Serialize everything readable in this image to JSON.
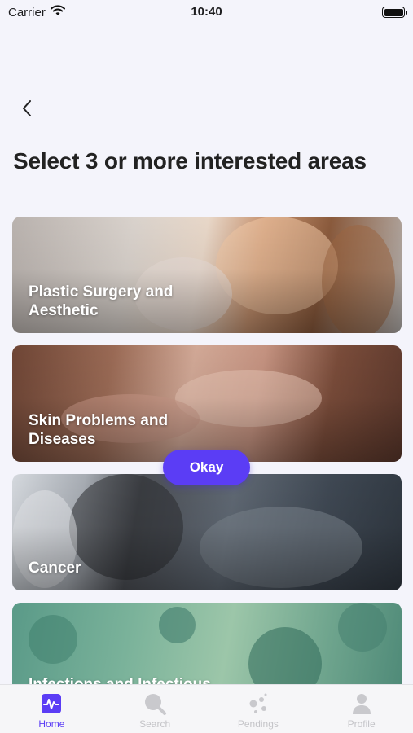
{
  "status_bar": {
    "carrier": "Carrier",
    "time": "10:40"
  },
  "page": {
    "title": "Select 3 or more interested areas"
  },
  "areas": [
    {
      "label": "Plastic Surgery and Aesthetic"
    },
    {
      "label": "Skin Problems and Diseases"
    },
    {
      "label": "Cancer"
    },
    {
      "label": "Infections and Infectious"
    }
  ],
  "okay_button": {
    "label": "Okay"
  },
  "tabs": [
    {
      "label": "Home",
      "icon": "activity-icon",
      "active": true
    },
    {
      "label": "Search",
      "icon": "search-icon",
      "active": false
    },
    {
      "label": "Pendings",
      "icon": "dots-icon",
      "active": false
    },
    {
      "label": "Profile",
      "icon": "person-icon",
      "active": false
    }
  ],
  "colors": {
    "accent": "#5b3df5",
    "background": "#f4f4fb",
    "inactive_tab": "#c4c4c8"
  }
}
